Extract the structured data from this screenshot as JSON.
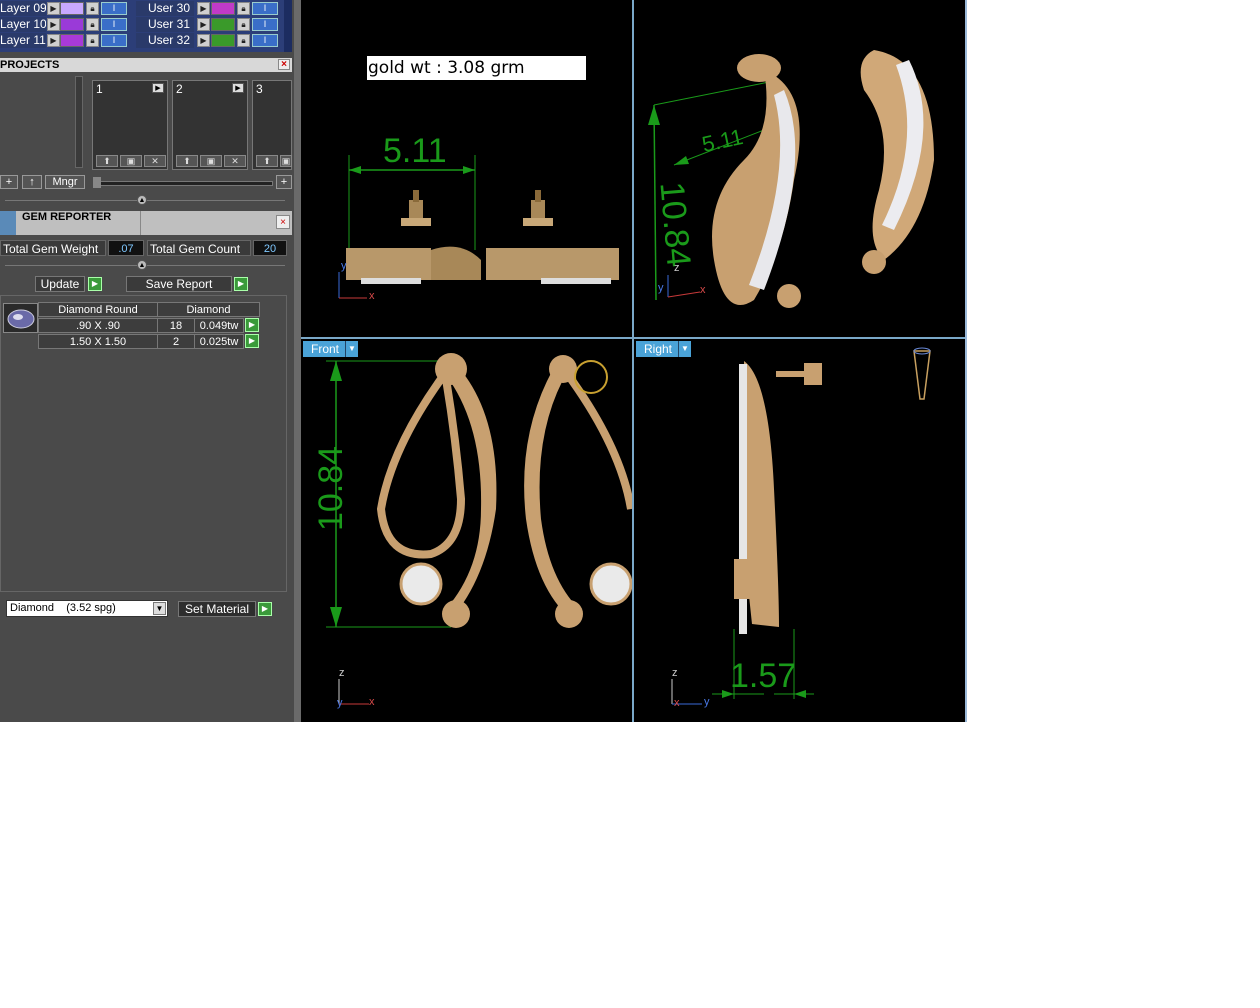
{
  "layers": {
    "left": [
      {
        "name": "Layer 09",
        "color": "#c8a8ff"
      },
      {
        "name": "Layer 10",
        "color": "#9a3ad8"
      },
      {
        "name": "Layer 11",
        "color": "#a83ad8"
      }
    ],
    "right": [
      {
        "name": "User 30",
        "color": "#c03ac8"
      },
      {
        "name": "User 31",
        "color": "#3a9a2a"
      },
      {
        "name": "User 32",
        "color": "#3a9a2a"
      }
    ],
    "button_glyph": "I"
  },
  "projects": {
    "header": "PROJECTS",
    "close": "×",
    "slots": [
      "1",
      "2",
      "3"
    ],
    "add_label": "+",
    "up_label": "↑",
    "manager_label": "Mngr",
    "zoom_plus": "+"
  },
  "gem_reporter": {
    "header": "GEM REPORTER",
    "close": "×",
    "total_weight_label": "Total Gem Weight",
    "total_weight_value": ".07",
    "total_count_label": "Total Gem Count",
    "total_count_value": "20",
    "update_label": "Update",
    "save_report_label": "Save Report",
    "table_headers": [
      "Diamond Round",
      "Diamond"
    ],
    "rows": [
      {
        "size": ".90 X .90",
        "count": "18",
        "weight": "0.049tw"
      },
      {
        "size": "1.50 X 1.50",
        "count": "2",
        "weight": "0.025tw"
      }
    ],
    "material_select": "Diamond    (3.52 spg)",
    "set_material_label": "Set Material"
  },
  "viewports": {
    "gold_weight_note": "gold wt : 3.08 grm",
    "top_dim_width": "5.11",
    "persp_dim_width": "5.11",
    "persp_dim_height": "10.84",
    "front_label": "Front",
    "front_dim_height": "10.84",
    "right_label": "Right",
    "right_dim_depth": "1.57",
    "axis_x": "x",
    "axis_y": "y",
    "axis_z": "z"
  }
}
